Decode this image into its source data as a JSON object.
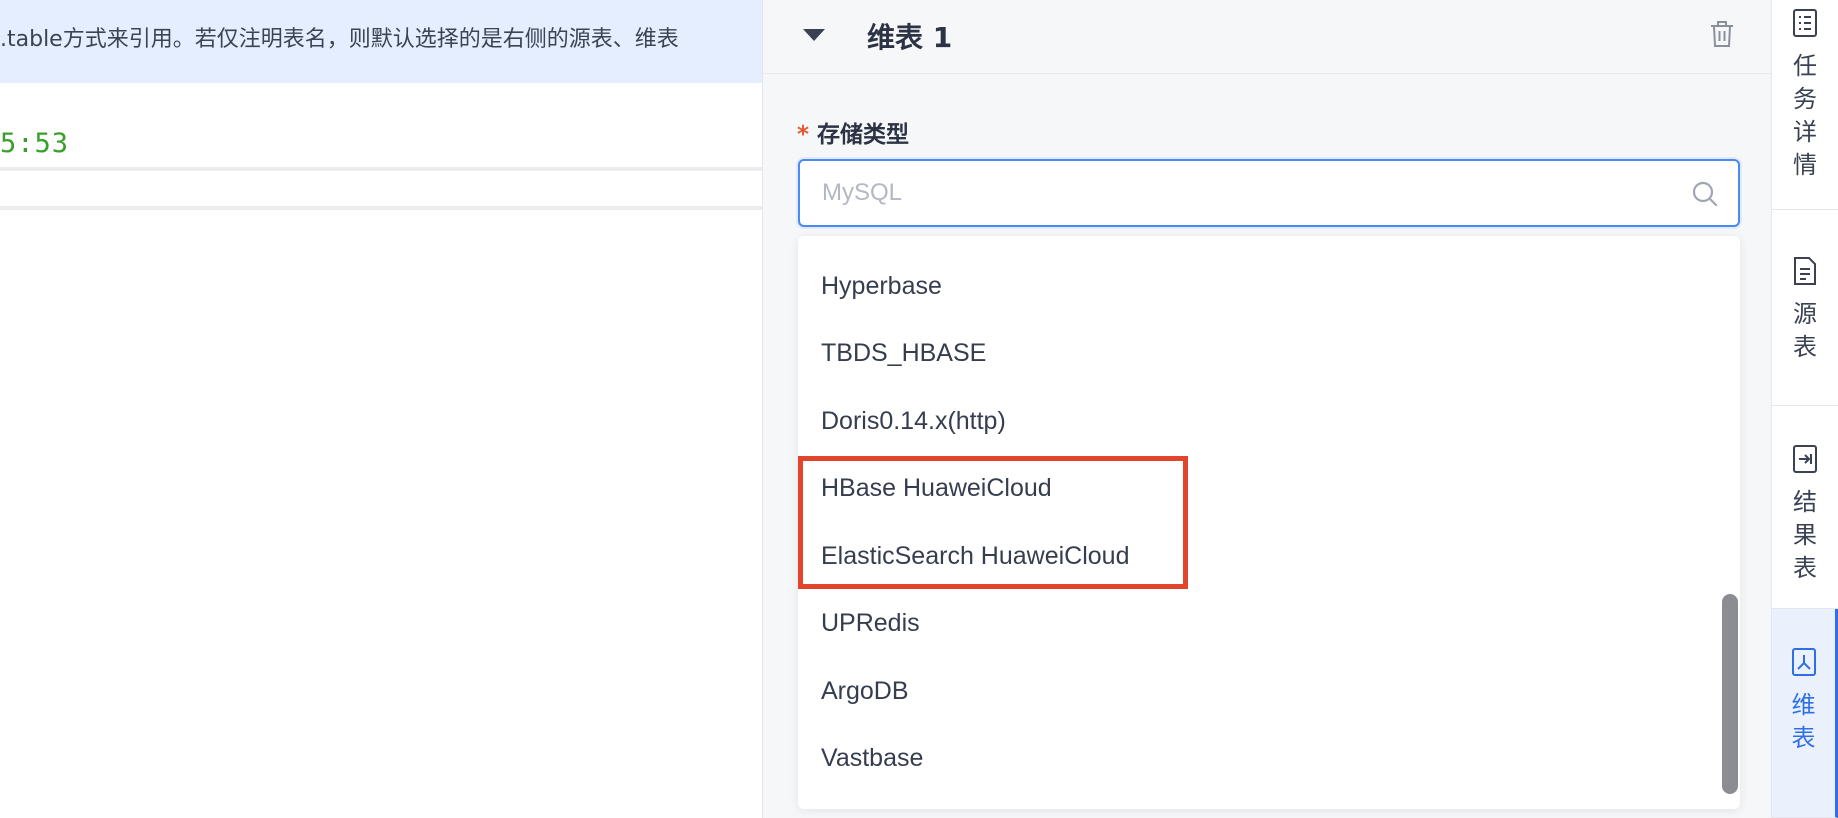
{
  "editor": {
    "hint_text": ".table方式来引用。若仅注明表名，则默认选择的是右侧的源表、维表",
    "code_fragment": "5:53"
  },
  "panel": {
    "title": "维表 1",
    "field_label": "存储类型",
    "required_mark": "*",
    "select": {
      "placeholder": "MySQL",
      "value": ""
    },
    "options": [
      "Hyperbase",
      "TBDS_HBASE",
      "Doris0.14.x(http)",
      "HBase HuaweiCloud",
      "ElasticSearch HuaweiCloud",
      "UPRedis",
      "ArgoDB",
      "Vastbase"
    ],
    "highlight_color": "#e2442c"
  },
  "rail": {
    "tabs": [
      {
        "label": "任务详情",
        "icon": "list-icon",
        "active": false
      },
      {
        "label": "源表",
        "icon": "document-icon",
        "active": false
      },
      {
        "label": "结果表",
        "icon": "export-icon",
        "active": false
      },
      {
        "label": "维表",
        "icon": "dimension-icon",
        "active": true
      }
    ]
  },
  "colors": {
    "accent": "#2f6fe6",
    "input_border": "#4a8af4",
    "hint_bg": "#e5eefe",
    "code_green": "#38a02a"
  }
}
